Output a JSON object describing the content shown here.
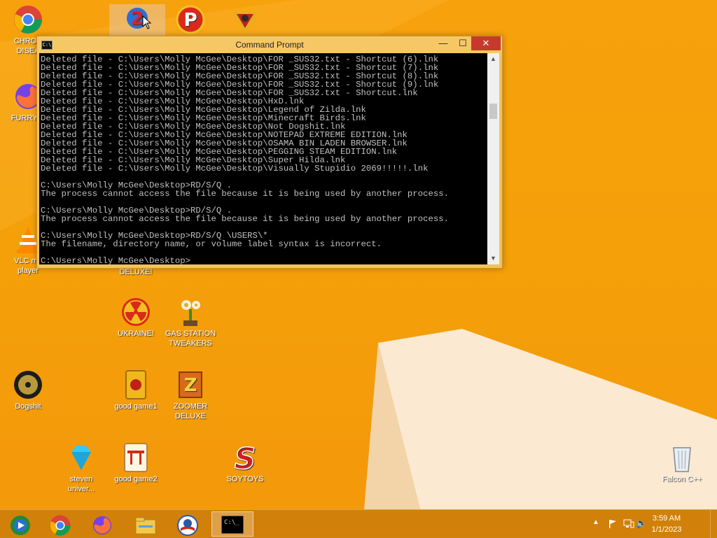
{
  "desktop": {
    "icons": [
      {
        "label": "CHRON\nDISEA"
      },
      {
        "label": "FURRY C"
      },
      {
        "label": "VLC me\nplayer"
      },
      {
        "label": "Dogshit"
      },
      {
        "label": "steven\nuniver..."
      },
      {
        "label": "DELUXE!"
      },
      {
        "label": "UKRAINE!"
      },
      {
        "label": "good game1"
      },
      {
        "label": "good game2"
      },
      {
        "label": "GAS STATION\nTWEAKERS"
      },
      {
        "label": "ZOOMER\nDELUXE"
      },
      {
        "label": "SOYTOYS"
      },
      {
        "label": "Falcon C++"
      }
    ]
  },
  "window": {
    "title": "Command Prompt",
    "icon_text": "C:\\",
    "minimize": "—",
    "maximize": "☐",
    "close": "✕",
    "output": "Deleted file - C:\\Users\\Molly McGee\\Desktop\\FOR _SUS32.txt - Shortcut (6).lnk\nDeleted file - C:\\Users\\Molly McGee\\Desktop\\FOR _SUS32.txt - Shortcut (7).lnk\nDeleted file - C:\\Users\\Molly McGee\\Desktop\\FOR _SUS32.txt - Shortcut (8).lnk\nDeleted file - C:\\Users\\Molly McGee\\Desktop\\FOR _SUS32.txt - Shortcut (9).lnk\nDeleted file - C:\\Users\\Molly McGee\\Desktop\\FOR _SUS32.txt - Shortcut.lnk\nDeleted file - C:\\Users\\Molly McGee\\Desktop\\HxD.lnk\nDeleted file - C:\\Users\\Molly McGee\\Desktop\\Legend of Zilda.lnk\nDeleted file - C:\\Users\\Molly McGee\\Desktop\\Minecraft Birds.lnk\nDeleted file - C:\\Users\\Molly McGee\\Desktop\\Not Dogshit.lnk\nDeleted file - C:\\Users\\Molly McGee\\Desktop\\NOTEPAD EXTREME EDITION.lnk\nDeleted file - C:\\Users\\Molly McGee\\Desktop\\OSAMA BIN LADEN BROWSER.lnk\nDeleted file - C:\\Users\\Molly McGee\\Desktop\\PEGGING STEAM EDITION.lnk\nDeleted file - C:\\Users\\Molly McGee\\Desktop\\Super Hilda.lnk\nDeleted file - C:\\Users\\Molly McGee\\Desktop\\Visually Stupidio 2069!!!!!.lnk\n\nC:\\Users\\Molly McGee\\Desktop>RD/S/Q .\nThe process cannot access the file because it is being used by another process.\n\nC:\\Users\\Molly McGee\\Desktop>RD/S/Q .\nThe process cannot access the file because it is being used by another process.\n\nC:\\Users\\Molly McGee\\Desktop>RD/S/Q \\USERS\\*\nThe filename, directory name, or volume label syntax is incorrect.\n\nC:\\Users\\Molly McGee\\Desktop>"
  },
  "taskbar": {
    "clock_time": "3:59 AM",
    "clock_date": "1/1/2023",
    "cmd_icon_text": "C:\\_"
  },
  "colors": {
    "desktop_bg": "#f5a009",
    "window_frame": "#f6c865",
    "close_red": "#c7392b",
    "console_bg": "#000000",
    "console_text": "#c0c0c0"
  }
}
